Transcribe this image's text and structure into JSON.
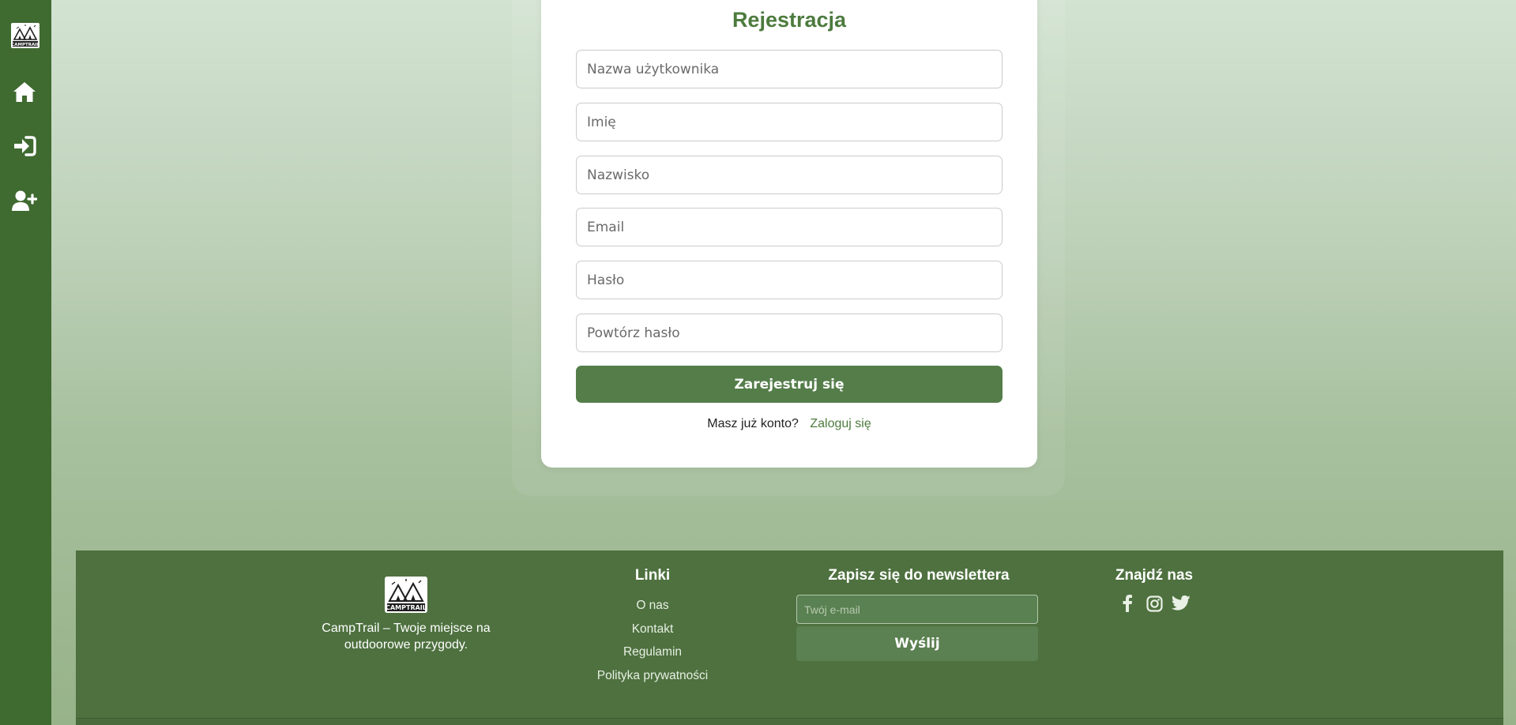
{
  "sidebar": {
    "logo_text": "CAMPTRAIL",
    "items": [
      {
        "name": "home",
        "icon": "home-icon"
      },
      {
        "name": "login",
        "icon": "sign-in-icon"
      },
      {
        "name": "register",
        "icon": "user-plus-icon"
      }
    ]
  },
  "form": {
    "title": "Rejestracja",
    "fields": [
      {
        "placeholder": "Nazwa użytkownika",
        "value": ""
      },
      {
        "placeholder": "Imię",
        "value": ""
      },
      {
        "placeholder": "Nazwisko",
        "value": ""
      },
      {
        "placeholder": "Email",
        "value": ""
      },
      {
        "placeholder": "Hasło",
        "value": ""
      },
      {
        "placeholder": "Powtórz hasło",
        "value": ""
      }
    ],
    "submit_label": "Zarejestruj się",
    "login_question": "Masz już konto?",
    "login_link": "Zaloguj się"
  },
  "footer": {
    "brand": {
      "logo_text": "CAMPTRAIL",
      "tagline": "CampTrail – Twoje miejsce na outdoorowe przygody."
    },
    "links": {
      "title": "Linki",
      "items": [
        "O nas",
        "Kontakt",
        "Regulamin",
        "Polityka prywatności"
      ]
    },
    "newsletter": {
      "title": "Zapisz się do newslettera",
      "email_placeholder": "Twój e-mail",
      "button_label": "Wyślij"
    },
    "social": {
      "title": "Znajdź nas",
      "icons": [
        "facebook-icon",
        "instagram-icon",
        "twitter-icon"
      ]
    }
  },
  "colors": {
    "sidebar": "#3f6a30",
    "accent": "#4d7b3e",
    "button": "#547d4a",
    "footer": "#4e713f"
  }
}
